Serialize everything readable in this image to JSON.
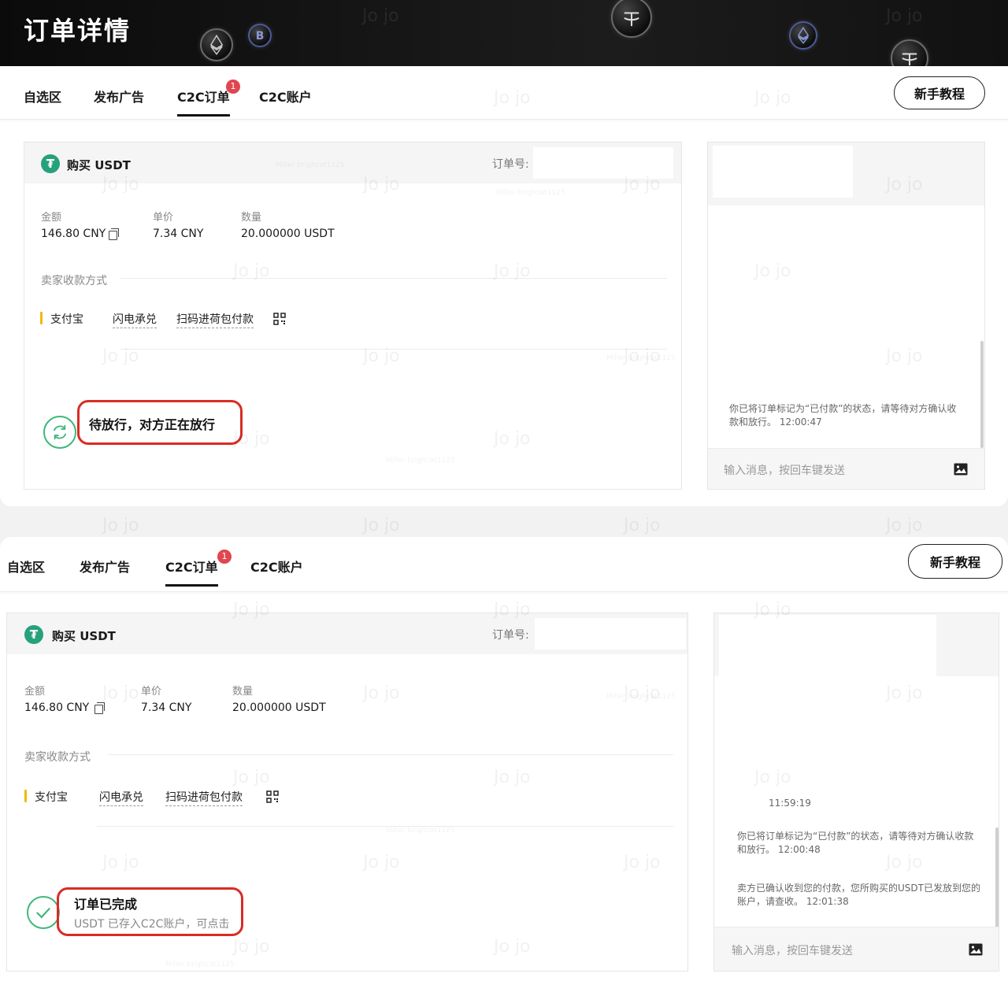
{
  "header": {
    "title": "订单详情",
    "coins": [
      "ethereum-coin",
      "bitcoin-coin",
      "tether-coin",
      "ethereum-coin",
      "tether-coin"
    ]
  },
  "nav": {
    "items": [
      "自选区",
      "发布广告",
      "C2C订单",
      "C2C账户"
    ],
    "active": "C2C订单",
    "badge": "1",
    "tutorial": "新手教程"
  },
  "order_card": {
    "buy_title": "购买 USDT",
    "order_no_label": "订单号:",
    "amount_label": "金额",
    "amount_value": "146.80 CNY",
    "price_label": "单价",
    "price_value": "7.34 CNY",
    "qty_label": "数量",
    "qty_value": "20.000000 USDT",
    "seller_pay_label": "卖家收款方式",
    "pay_method": "支付宝",
    "pay_link1": "闪电承兑",
    "pay_link2": "扫码进荷包付款"
  },
  "top_status": {
    "text": "待放行，对方正在放行"
  },
  "bottom_status": {
    "title": "订单已完成",
    "sub": "USDT 已存入C2C账户，可点击"
  },
  "chat_top": {
    "messages": [
      {
        "text": "你已将订单标记为“已付款”的状态，请等待对方确认收款和放行。 12:00:47"
      }
    ],
    "placeholder": "输入消息，按回车键发送"
  },
  "chat_bottom": {
    "time": "11:59:19",
    "messages": [
      {
        "text": "你已将订单标记为“已付款”的状态，请等待对方确认收款和放行。 12:00:48"
      },
      {
        "text": "卖方已确认收到您的付款，您所购买的USDT已发放到您的账户，请查收。 12:01:38"
      }
    ],
    "placeholder": "输入消息，按回车键发送"
  },
  "watermarks": [
    "Jo jo",
    "Miller brighcat1125"
  ],
  "colors": {
    "tether_green": "#26a17b",
    "status_green": "#3cb878",
    "highlight_red": "#d92c25",
    "badge_red": "#e0464f",
    "alipay_bar": "#f0b90b"
  }
}
